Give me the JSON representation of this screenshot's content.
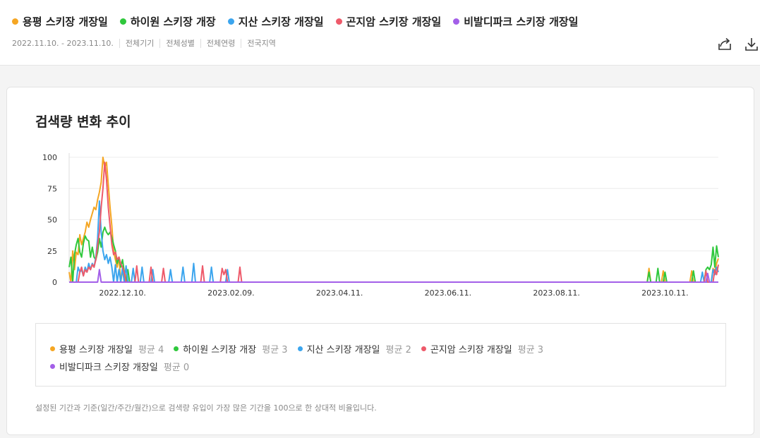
{
  "header": {
    "keywords": [
      {
        "label": "용평 스키장 개장일",
        "color": "#f5a623"
      },
      {
        "label": "하이원 스키장 개장",
        "color": "#2fc83c"
      },
      {
        "label": "지산 스키장 개장일",
        "color": "#3ba5ee"
      },
      {
        "label": "곤지암 스키장 개장일",
        "color": "#ee5a6a"
      },
      {
        "label": "비발디파크 스키장 개장일",
        "color": "#a35fe8"
      }
    ],
    "filters": [
      "2022.11.10. - 2023.11.10.",
      "전체기기",
      "전체성별",
      "전체연령",
      "전국지역"
    ],
    "share_icon": "share-icon",
    "download_icon": "download-icon"
  },
  "card": {
    "title": "검색량 변화 추이",
    "legend": [
      {
        "name": "용평 스키장 개장일",
        "avg": "평균 4",
        "color": "#f5a623"
      },
      {
        "name": "하이원 스키장 개장",
        "avg": "평균 3",
        "color": "#2fc83c"
      },
      {
        "name": "지산 스키장 개장일",
        "avg": "평균 2",
        "color": "#3ba5ee"
      },
      {
        "name": "곤지암 스키장 개장일",
        "avg": "평균 3",
        "color": "#ee5a6a"
      },
      {
        "name": "비발디파크 스키장 개장일",
        "avg": "평균 0",
        "color": "#a35fe8"
      }
    ],
    "footnote": "설정된 기간과 기준(일간/주간/월간)으로 검색량 유입이 가장 많은 기간을 100으로 한 상대적 비율입니다."
  },
  "chart_data": {
    "type": "line",
    "xlim": [
      "2022-11-10",
      "2023-11-10"
    ],
    "ylim": [
      0,
      100
    ],
    "yticks": [
      "0",
      "25",
      "50",
      "75",
      "100"
    ],
    "xticks": [
      {
        "date": "2022-12-10",
        "label": "2022.12.10."
      },
      {
        "date": "2023-02-09",
        "label": "2023.02.09."
      },
      {
        "date": "2023-04-11",
        "label": "2023.04.11."
      },
      {
        "date": "2023-06-11",
        "label": "2023.06.11."
      },
      {
        "date": "2023-08-11",
        "label": "2023.08.11."
      },
      {
        "date": "2023-10-11",
        "label": "2023.10.11."
      }
    ],
    "grid": true,
    "series": [
      {
        "name": "용평 스키장 개장일",
        "color": "#f5a623",
        "points": [
          [
            "2022-11-10",
            8
          ],
          [
            "2022-11-11",
            0
          ],
          [
            "2022-11-12",
            25
          ],
          [
            "2022-11-13",
            10
          ],
          [
            "2022-11-14",
            24
          ],
          [
            "2022-11-15",
            22
          ],
          [
            "2022-11-16",
            38
          ],
          [
            "2022-11-17",
            30
          ],
          [
            "2022-11-18",
            35
          ],
          [
            "2022-11-19",
            40
          ],
          [
            "2022-11-20",
            48
          ],
          [
            "2022-11-21",
            44
          ],
          [
            "2022-11-22",
            50
          ],
          [
            "2022-11-23",
            55
          ],
          [
            "2022-11-24",
            60
          ],
          [
            "2022-11-25",
            58
          ],
          [
            "2022-11-26",
            66
          ],
          [
            "2022-11-27",
            72
          ],
          [
            "2022-11-28",
            80
          ],
          [
            "2022-11-29",
            100
          ],
          [
            "2022-11-30",
            92
          ],
          [
            "2022-12-01",
            96
          ],
          [
            "2022-12-02",
            78
          ],
          [
            "2022-12-03",
            60
          ],
          [
            "2022-12-04",
            45
          ],
          [
            "2022-12-05",
            25
          ],
          [
            "2022-12-06",
            18
          ],
          [
            "2022-12-07",
            12
          ],
          [
            "2022-12-08",
            20
          ],
          [
            "2022-12-09",
            0
          ],
          [
            "2022-12-10",
            10
          ],
          [
            "2022-12-11",
            0
          ],
          [
            "2022-12-12",
            6
          ],
          [
            "2022-12-13",
            0
          ],
          [
            "2022-12-14",
            0
          ],
          [
            "2023-10-01",
            0
          ],
          [
            "2023-10-02",
            11
          ],
          [
            "2023-10-03",
            0
          ],
          [
            "2023-10-09",
            0
          ],
          [
            "2023-10-10",
            9
          ],
          [
            "2023-10-11",
            0
          ],
          [
            "2023-10-25",
            0
          ],
          [
            "2023-10-26",
            9
          ],
          [
            "2023-10-27",
            0
          ],
          [
            "2023-11-06",
            0
          ],
          [
            "2023-11-07",
            11
          ],
          [
            "2023-11-08",
            8
          ],
          [
            "2023-11-09",
            15
          ],
          [
            "2023-11-10",
            19
          ]
        ]
      },
      {
        "name": "하이원 스키장 개장",
        "color": "#2fc83c",
        "points": [
          [
            "2022-11-10",
            12
          ],
          [
            "2022-11-11",
            20
          ],
          [
            "2022-11-12",
            0
          ],
          [
            "2022-11-13",
            22
          ],
          [
            "2022-11-14",
            30
          ],
          [
            "2022-11-15",
            35
          ],
          [
            "2022-11-16",
            24
          ],
          [
            "2022-11-17",
            20
          ],
          [
            "2022-11-18",
            31
          ],
          [
            "2022-11-19",
            37
          ],
          [
            "2022-11-20",
            34
          ],
          [
            "2022-11-21",
            33
          ],
          [
            "2022-11-22",
            20
          ],
          [
            "2022-11-23",
            28
          ],
          [
            "2022-11-24",
            20
          ],
          [
            "2022-11-25",
            18
          ],
          [
            "2022-11-26",
            24
          ],
          [
            "2022-11-27",
            35
          ],
          [
            "2022-11-28",
            28
          ],
          [
            "2022-11-29",
            40
          ],
          [
            "2022-11-30",
            44
          ],
          [
            "2022-12-01",
            40
          ],
          [
            "2022-12-02",
            38
          ],
          [
            "2022-12-03",
            40
          ],
          [
            "2022-12-04",
            36
          ],
          [
            "2022-12-05",
            30
          ],
          [
            "2022-12-06",
            25
          ],
          [
            "2022-12-07",
            15
          ],
          [
            "2022-12-08",
            20
          ],
          [
            "2022-12-09",
            12
          ],
          [
            "2022-12-10",
            18
          ],
          [
            "2022-12-11",
            8
          ],
          [
            "2022-12-12",
            0
          ],
          [
            "2022-12-13",
            10
          ],
          [
            "2022-12-14",
            0
          ],
          [
            "2023-10-01",
            0
          ],
          [
            "2023-10-02",
            8
          ],
          [
            "2023-10-03",
            0
          ],
          [
            "2023-10-06",
            0
          ],
          [
            "2023-10-07",
            11
          ],
          [
            "2023-10-08",
            0
          ],
          [
            "2023-10-10",
            0
          ],
          [
            "2023-10-11",
            8
          ],
          [
            "2023-10-12",
            0
          ],
          [
            "2023-10-26",
            0
          ],
          [
            "2023-10-27",
            9
          ],
          [
            "2023-10-28",
            0
          ],
          [
            "2023-11-02",
            0
          ],
          [
            "2023-11-03",
            10
          ],
          [
            "2023-11-04",
            12
          ],
          [
            "2023-11-05",
            10
          ],
          [
            "2023-11-06",
            14
          ],
          [
            "2023-11-07",
            28
          ],
          [
            "2023-11-08",
            12
          ],
          [
            "2023-11-09",
            29
          ],
          [
            "2023-11-10",
            20
          ]
        ]
      },
      {
        "name": "지산 스키장 개장일",
        "color": "#3ba5ee",
        "points": [
          [
            "2022-11-10",
            0
          ],
          [
            "2022-11-14",
            0
          ],
          [
            "2022-11-15",
            12
          ],
          [
            "2022-11-16",
            8
          ],
          [
            "2022-11-17",
            10
          ],
          [
            "2022-11-18",
            5
          ],
          [
            "2022-11-19",
            12
          ],
          [
            "2022-11-20",
            8
          ],
          [
            "2022-11-21",
            15
          ],
          [
            "2022-11-22",
            10
          ],
          [
            "2022-11-23",
            15
          ],
          [
            "2022-11-24",
            12
          ],
          [
            "2022-11-25",
            20
          ],
          [
            "2022-11-26",
            35
          ],
          [
            "2022-11-27",
            65
          ],
          [
            "2022-11-28",
            40
          ],
          [
            "2022-11-29",
            25
          ],
          [
            "2022-11-30",
            18
          ],
          [
            "2022-12-01",
            22
          ],
          [
            "2022-12-02",
            15
          ],
          [
            "2022-12-03",
            20
          ],
          [
            "2022-12-04",
            12
          ],
          [
            "2022-12-05",
            0
          ],
          [
            "2022-12-06",
            14
          ],
          [
            "2022-12-07",
            0
          ],
          [
            "2022-12-08",
            10
          ],
          [
            "2022-12-09",
            0
          ],
          [
            "2022-12-10",
            12
          ],
          [
            "2022-12-11",
            0
          ],
          [
            "2022-12-12",
            13
          ],
          [
            "2022-12-13",
            0
          ],
          [
            "2022-12-15",
            0
          ],
          [
            "2022-12-16",
            11
          ],
          [
            "2022-12-17",
            0
          ],
          [
            "2022-12-20",
            0
          ],
          [
            "2022-12-21",
            12
          ],
          [
            "2022-12-22",
            0
          ],
          [
            "2022-12-26",
            0
          ],
          [
            "2022-12-27",
            10
          ],
          [
            "2022-12-28",
            0
          ],
          [
            "2023-01-05",
            0
          ],
          [
            "2023-01-06",
            10
          ],
          [
            "2023-01-07",
            0
          ],
          [
            "2023-01-12",
            0
          ],
          [
            "2023-01-13",
            12
          ],
          [
            "2023-01-14",
            0
          ],
          [
            "2023-01-18",
            0
          ],
          [
            "2023-01-19",
            15
          ],
          [
            "2023-01-20",
            0
          ],
          [
            "2023-01-28",
            0
          ],
          [
            "2023-01-29",
            12
          ],
          [
            "2023-01-30",
            0
          ],
          [
            "2023-02-06",
            0
          ],
          [
            "2023-02-07",
            10
          ],
          [
            "2023-02-08",
            0
          ],
          [
            "2023-10-31",
            0
          ],
          [
            "2023-11-01",
            8
          ],
          [
            "2023-11-02",
            0
          ],
          [
            "2023-11-06",
            0
          ],
          [
            "2023-11-07",
            10
          ],
          [
            "2023-11-08",
            6
          ],
          [
            "2023-11-09",
            12
          ],
          [
            "2023-11-10",
            8
          ]
        ]
      },
      {
        "name": "곤지암 스키장 개장일",
        "color": "#ee5a6a",
        "points": [
          [
            "2022-11-10",
            0
          ],
          [
            "2022-11-15",
            0
          ],
          [
            "2022-11-16",
            8
          ],
          [
            "2022-11-17",
            12
          ],
          [
            "2022-11-18",
            5
          ],
          [
            "2022-11-19",
            10
          ],
          [
            "2022-11-20",
            8
          ],
          [
            "2022-11-21",
            12
          ],
          [
            "2022-11-22",
            10
          ],
          [
            "2022-11-23",
            14
          ],
          [
            "2022-11-24",
            12
          ],
          [
            "2022-11-25",
            18
          ],
          [
            "2022-11-26",
            30
          ],
          [
            "2022-11-27",
            40
          ],
          [
            "2022-11-28",
            60
          ],
          [
            "2022-11-29",
            75
          ],
          [
            "2022-11-30",
            96
          ],
          [
            "2022-12-01",
            82
          ],
          [
            "2022-12-02",
            60
          ],
          [
            "2022-12-03",
            45
          ],
          [
            "2022-12-04",
            30
          ],
          [
            "2022-12-05",
            22
          ],
          [
            "2022-12-06",
            24
          ],
          [
            "2022-12-07",
            18
          ],
          [
            "2022-12-08",
            20
          ],
          [
            "2022-12-09",
            15
          ],
          [
            "2022-12-10",
            12
          ],
          [
            "2022-12-11",
            8
          ],
          [
            "2022-12-12",
            0
          ],
          [
            "2022-12-17",
            0
          ],
          [
            "2022-12-18",
            13
          ],
          [
            "2022-12-19",
            0
          ],
          [
            "2022-12-25",
            0
          ],
          [
            "2022-12-26",
            12
          ],
          [
            "2022-12-27",
            0
          ],
          [
            "2023-01-01",
            0
          ],
          [
            "2023-01-02",
            11
          ],
          [
            "2023-01-03",
            0
          ],
          [
            "2023-01-23",
            0
          ],
          [
            "2023-01-24",
            13
          ],
          [
            "2023-01-25",
            0
          ],
          [
            "2023-02-03",
            0
          ],
          [
            "2023-02-04",
            11
          ],
          [
            "2023-02-05",
            6
          ],
          [
            "2023-02-06",
            10
          ],
          [
            "2023-02-07",
            0
          ],
          [
            "2023-02-13",
            0
          ],
          [
            "2023-02-14",
            12
          ],
          [
            "2023-02-15",
            0
          ],
          [
            "2023-11-02",
            0
          ],
          [
            "2023-11-03",
            9
          ],
          [
            "2023-11-04",
            0
          ],
          [
            "2023-11-07",
            0
          ],
          [
            "2023-11-08",
            10
          ],
          [
            "2023-11-09",
            6
          ],
          [
            "2023-11-10",
            14
          ]
        ]
      },
      {
        "name": "비발디파크 스키장 개장일",
        "color": "#a35fe8",
        "points": [
          [
            "2022-11-10",
            0
          ],
          [
            "2022-11-26",
            0
          ],
          [
            "2022-11-27",
            10
          ],
          [
            "2022-11-28",
            0
          ],
          [
            "2023-11-03",
            0
          ],
          [
            "2023-11-04",
            7
          ],
          [
            "2023-11-05",
            0
          ],
          [
            "2023-11-10",
            0
          ]
        ]
      }
    ]
  }
}
